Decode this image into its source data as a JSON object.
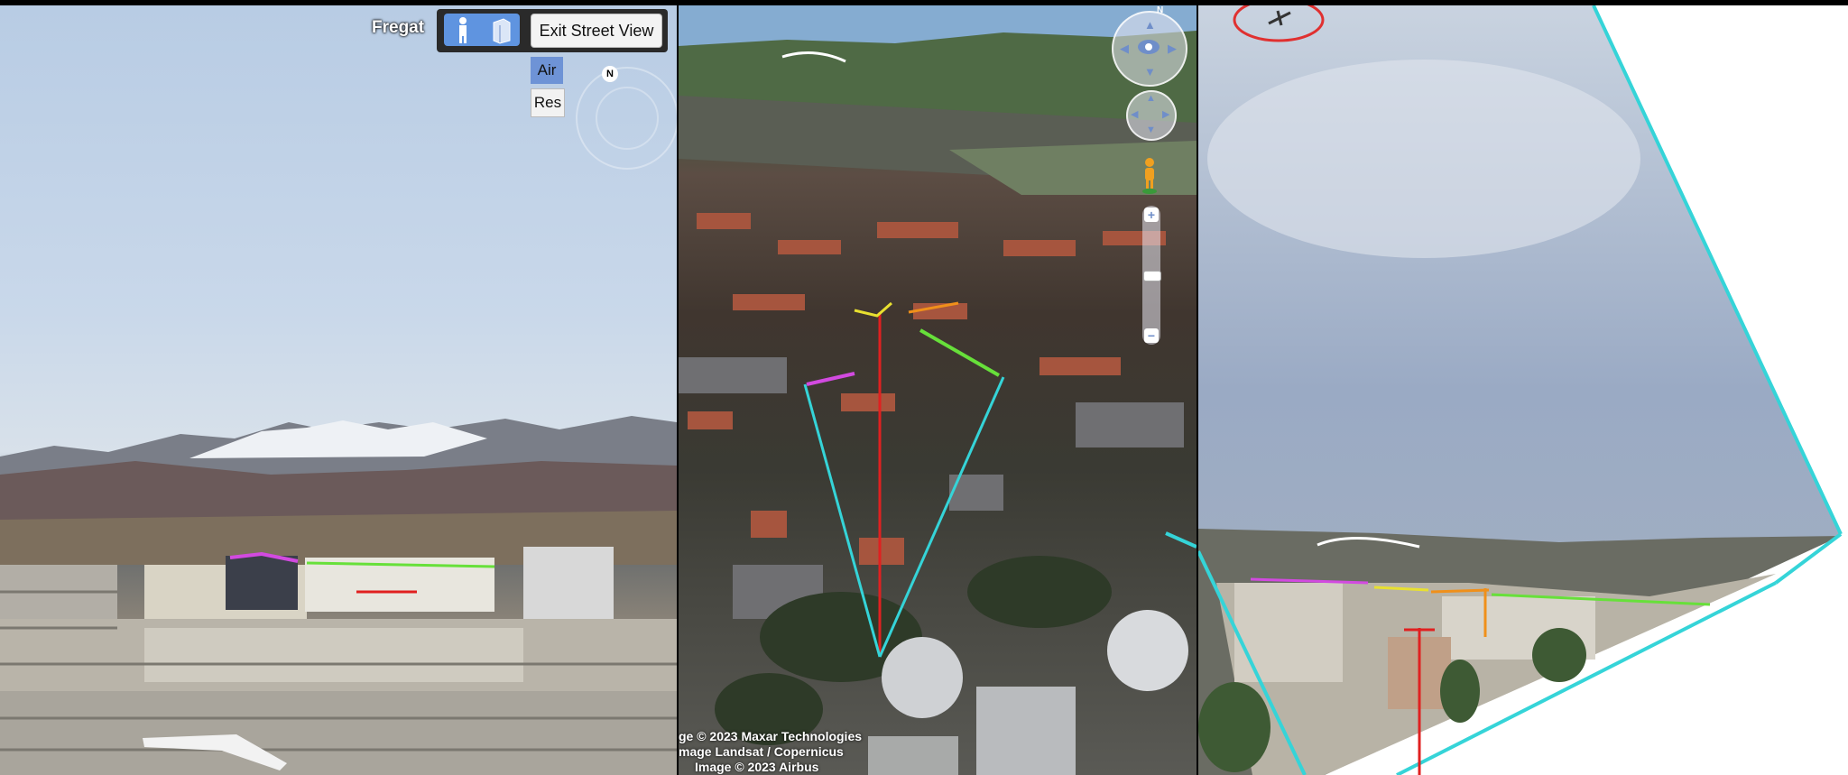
{
  "street_view": {
    "label": "Fregat",
    "exit_button": "Exit Street View",
    "layers": {
      "air": "Air",
      "res": "Res"
    },
    "compass_n": "N"
  },
  "aerial": {
    "compass_n": "N",
    "zoom_in": "+",
    "zoom_out": "−",
    "credits": [
      "ge © 2023 Maxar Technologies",
      "mage Landsat / Copernicus",
      "Image © 2023 Airbus"
    ]
  },
  "colors": {
    "marker_red": "#e02020",
    "marker_cyan": "#35d4d8",
    "marker_green": "#67e03a",
    "marker_magenta": "#d24ae0",
    "marker_yellow": "#e8e030",
    "marker_orange": "#f0901a",
    "ui_accent": "#5f94e0"
  }
}
